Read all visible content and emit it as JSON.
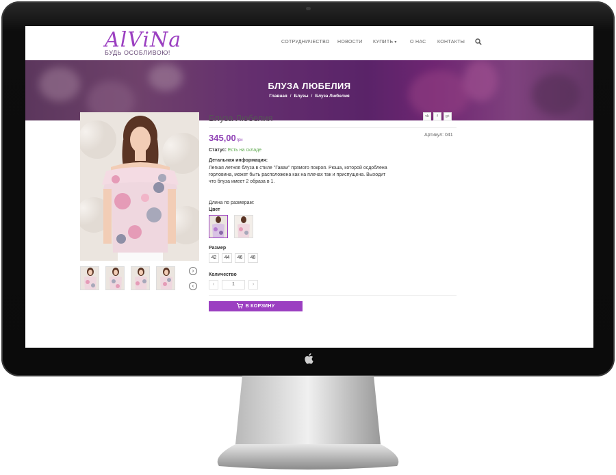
{
  "header": {
    "logo_text": "AlViNa",
    "logo_tagline": "БУДЬ ОСОБЛИВОЮ!",
    "nav": [
      {
        "label": "СОТРУДНИЧЕСТВО"
      },
      {
        "label": "НОВОСТИ"
      },
      {
        "label": "КУПИТЬ",
        "has_dropdown": true
      },
      {
        "label": "О НАС"
      },
      {
        "label": "КОНТАКТЫ"
      }
    ],
    "search_icon": "search-icon"
  },
  "hero": {
    "title": "БЛУЗА ЛЮБЕЛИЯ",
    "breadcrumb": [
      "Главная",
      "Блузы",
      "Блуза Любелия"
    ]
  },
  "product": {
    "title": "Блуза Любелия",
    "share": [
      "vk",
      "f",
      "g+"
    ],
    "price": "345,00",
    "currency": "грн",
    "sku": "Артикул: 041",
    "status_label": "Статус:",
    "status_value": "Есть на складе",
    "details_heading": "Детальная информация:",
    "details_text": "Легкая летняя блуза в стиле \"Гаваи\" прямого покроя. Рюша, которой осдоблена горловина, может быть расположена как на плечах так и приспущена. Выходит что блуза имеет 2 образа в 1.",
    "length_label": "Длина по размерам:",
    "color_label": "Цвет",
    "size_label": "Размер",
    "sizes": [
      "42",
      "44",
      "46",
      "48"
    ],
    "quantity_label": "Количество",
    "quantity_value": "1",
    "cart_button": "В КОРЗИНУ"
  },
  "colors": {
    "accent": "#9b3fc1",
    "status": "#5aa74a"
  }
}
